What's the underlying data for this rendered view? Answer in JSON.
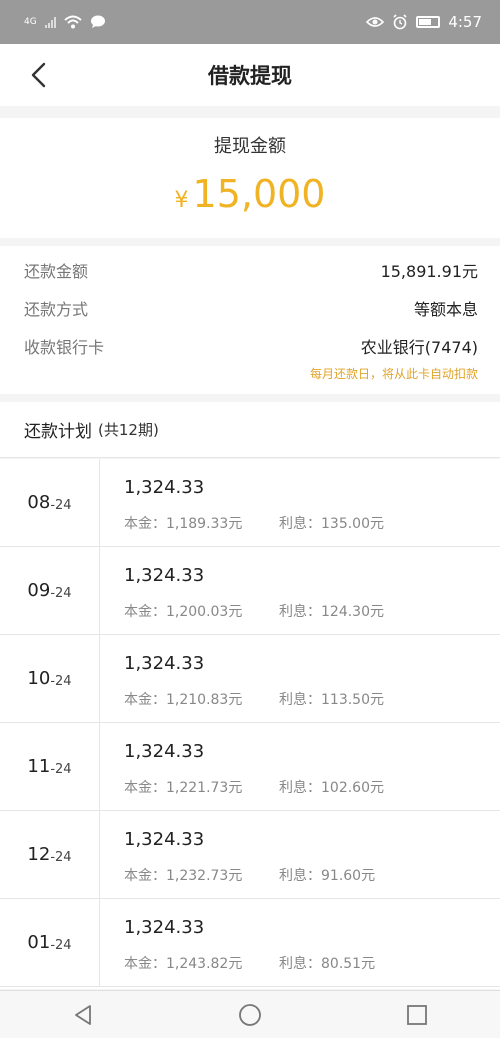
{
  "status_bar": {
    "network": "4G",
    "time": "4:57"
  },
  "header": {
    "title": "借款提现"
  },
  "amount": {
    "label": "提现金额",
    "currency": "¥",
    "value": "15,000"
  },
  "details": {
    "repay_amount_label": "还款金额",
    "repay_amount_value": "15,891.91元",
    "repay_method_label": "还款方式",
    "repay_method_value": "等额本息",
    "bank_label": "收款银行卡",
    "bank_value": "农业银行(7474)",
    "auto_debit_note": "每月还款日，将从此卡自动扣款"
  },
  "plan": {
    "title": "还款计划",
    "count": "(共12期)",
    "principal_label": "本金：",
    "interest_label": "利息：",
    "rows": [
      {
        "month": "08",
        "year": "-24",
        "amount": "1,324.33",
        "principal": "1,189.33元",
        "interest": "135.00元"
      },
      {
        "month": "09",
        "year": "-24",
        "amount": "1,324.33",
        "principal": "1,200.03元",
        "interest": "124.30元"
      },
      {
        "month": "10",
        "year": "-24",
        "amount": "1,324.33",
        "principal": "1,210.83元",
        "interest": "113.50元"
      },
      {
        "month": "11",
        "year": "-24",
        "amount": "1,324.33",
        "principal": "1,221.73元",
        "interest": "102.60元"
      },
      {
        "month": "12",
        "year": "-24",
        "amount": "1,324.33",
        "principal": "1,232.73元",
        "interest": "91.60元"
      },
      {
        "month": "01",
        "year": "-24",
        "amount": "1,324.33",
        "principal": "1,243.82元",
        "interest": "80.51元"
      }
    ]
  },
  "colors": {
    "accent": "#efb323",
    "note": "#e0a42a",
    "status_bar": "#9a9a9a"
  },
  "icons": [
    "signal-icon",
    "wifi-icon",
    "message-icon",
    "eye-icon",
    "alarm-icon",
    "battery-icon",
    "back-arrow-icon",
    "nav-back-icon",
    "nav-home-icon",
    "nav-recents-icon"
  ]
}
